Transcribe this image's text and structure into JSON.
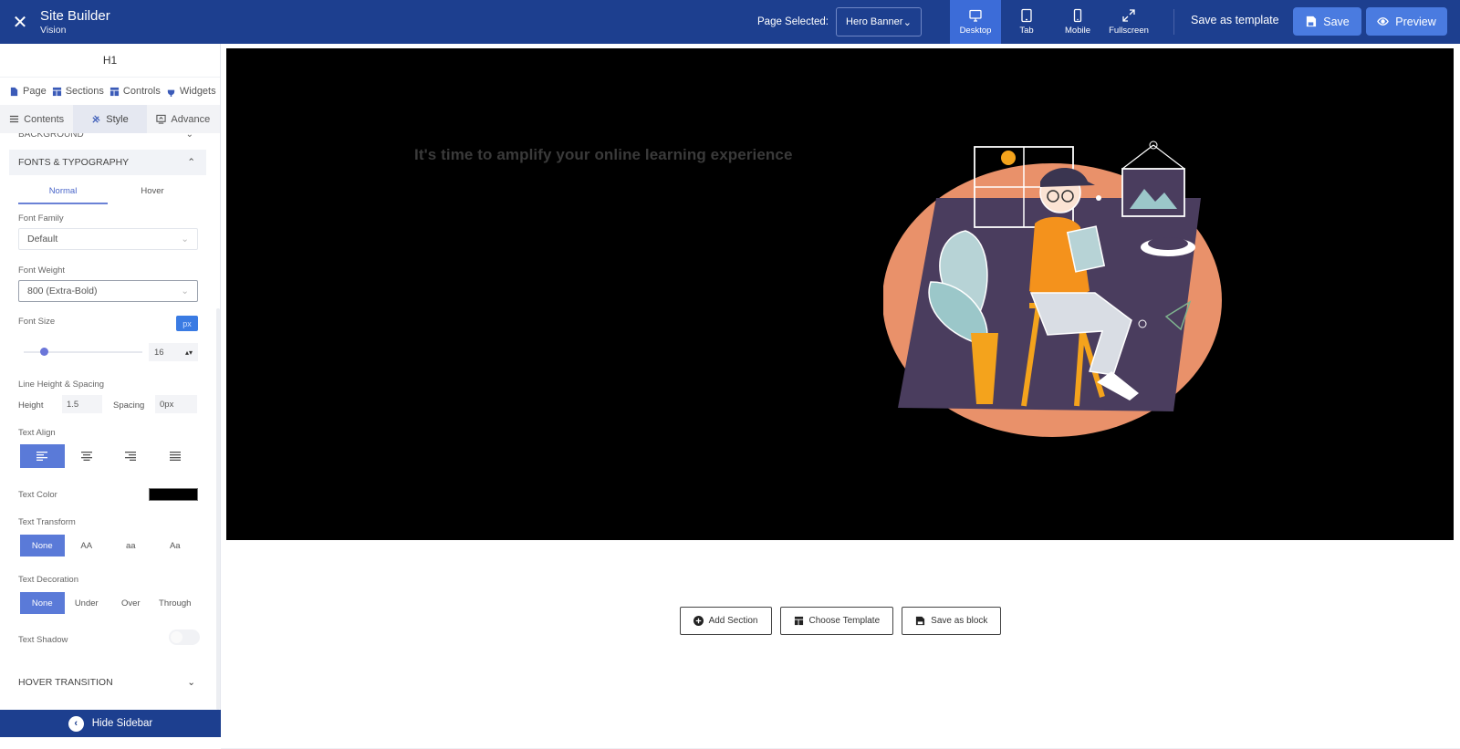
{
  "header": {
    "close_label": "✕",
    "app_title": "Site Builder",
    "app_subtitle": "Vision",
    "page_selected_label": "Page Selected:",
    "page_selected_value": "Hero Banner",
    "devices": [
      {
        "label": "Desktop",
        "active": true
      },
      {
        "label": "Tab",
        "active": false
      },
      {
        "label": "Mobile",
        "active": false
      },
      {
        "label": "Fullscreen",
        "active": false
      }
    ],
    "save_as_template": "Save as template",
    "save": "Save",
    "preview": "Preview",
    "colors": {
      "bar": "#1d3f8f",
      "active": "#3c6cd8",
      "button": "#4a7be0"
    }
  },
  "sidebar": {
    "element_title": "H1",
    "main_tabs": [
      "Page",
      "Sections",
      "Controls",
      "Widgets"
    ],
    "sub_tabs": [
      "Contents",
      "Style",
      "Advance"
    ],
    "active_sub_tab": "Style",
    "cut_section": "BACKGROUND",
    "section_title": "FONTS & TYPOGRAPHY",
    "state_tabs": [
      "Normal",
      "Hover"
    ],
    "font_family": {
      "label": "Font Family",
      "value": "Default"
    },
    "font_weight": {
      "label": "Font Weight",
      "value": "800 (Extra-Bold)"
    },
    "font_size": {
      "label": "Font Size",
      "unit": "px",
      "value": "16"
    },
    "line_height_spacing": {
      "label": "Line Height & Spacing",
      "height_label": "Height",
      "height_value": "1.5",
      "spacing_label": "Spacing",
      "spacing_value": "0px"
    },
    "text_align": {
      "label": "Text Align",
      "options": [
        "left",
        "center",
        "right",
        "justify"
      ],
      "selected": "left"
    },
    "text_color": {
      "label": "Text Color",
      "value": "#000000"
    },
    "text_transform": {
      "label": "Text Transform",
      "options": [
        "None",
        "AA",
        "aa",
        "Aa"
      ],
      "selected": "None"
    },
    "text_decoration": {
      "label": "Text Decoration",
      "options": [
        "None",
        "Under",
        "Over",
        "Through"
      ],
      "selected": "None"
    },
    "text_shadow": {
      "label": "Text Shadow",
      "enabled": false
    },
    "hover_transition": "HOVER TRANSITION",
    "hide_sidebar": "Hide Sidebar"
  },
  "canvas": {
    "hero_heading": "It's time to amplify your online learning experience",
    "hero_bg": "#000000",
    "actions": [
      "Add Section",
      "Choose Template",
      "Save as block"
    ]
  }
}
